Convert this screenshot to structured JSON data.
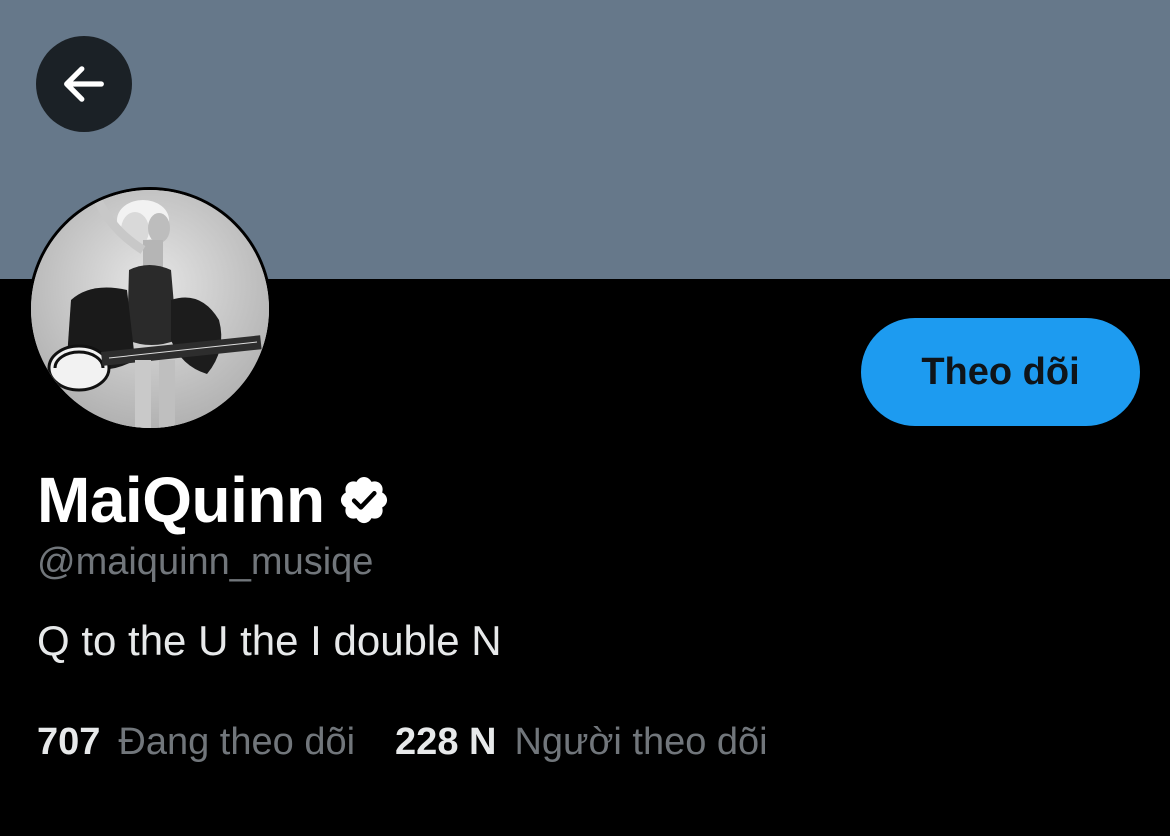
{
  "banner": {
    "color": "#66788a"
  },
  "header": {
    "back_icon": "arrow-left-icon"
  },
  "profile": {
    "display_name": "MaiQuinn",
    "verified_icon": "verified-badge-icon",
    "handle": "@maiquinn_musiqe",
    "bio": "Q to the U the I double N",
    "avatar_description": "avatar-photo"
  },
  "actions": {
    "follow_label": "Theo dõi",
    "accent_color": "#1d9bf0"
  },
  "stats": {
    "following_count": "707",
    "following_label": "Đang theo dõi",
    "followers_count": "228 N",
    "followers_label": "Người theo dõi"
  }
}
